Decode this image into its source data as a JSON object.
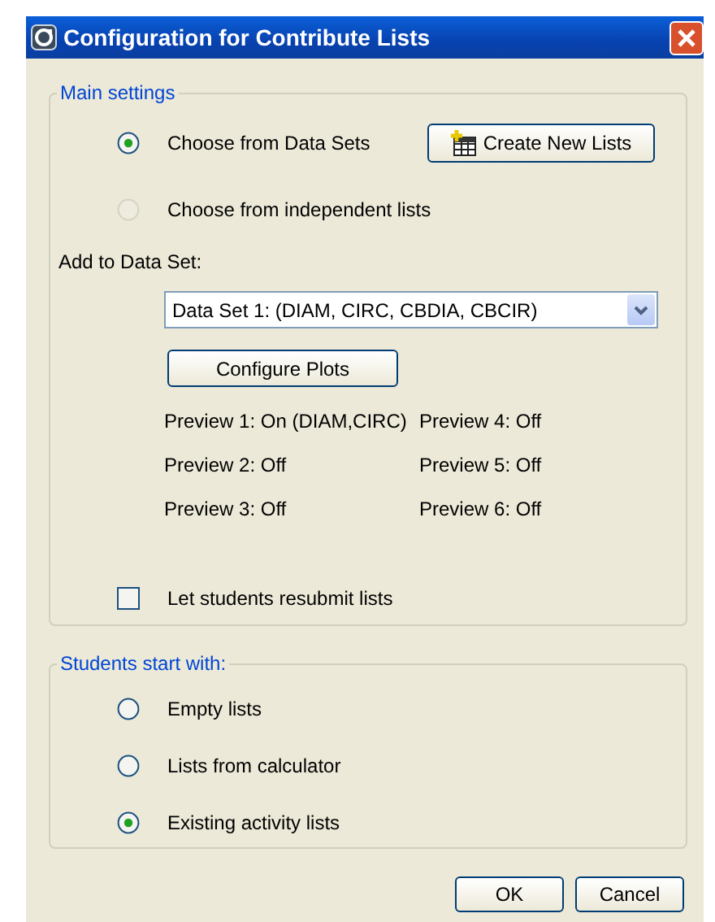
{
  "window": {
    "title": "Configuration for Contribute Lists"
  },
  "main_settings": {
    "legend": "Main settings",
    "source_options": [
      {
        "label": "Choose from Data Sets",
        "selected": true,
        "disabled": false
      },
      {
        "label": "Choose from independent lists",
        "selected": false,
        "disabled": true
      }
    ],
    "create_button": "Create New Lists",
    "add_to_label": "Add to Data Set:",
    "data_set": {
      "value": "Data Set 1: (DIAM, CIRC, CBDIA, CBCIR)"
    },
    "configure_button": "Configure Plots",
    "previews": [
      "Preview 1: On (DIAM,CIRC)",
      "Preview 2: Off",
      "Preview 3: Off",
      "Preview 4: Off",
      "Preview 5: Off",
      "Preview 6: Off"
    ],
    "resubmit": {
      "label": "Let students resubmit lists",
      "checked": false
    }
  },
  "students_start": {
    "legend": "Students start with:",
    "options": [
      {
        "label": "Empty lists",
        "selected": false
      },
      {
        "label": "Lists from calculator",
        "selected": false
      },
      {
        "label": "Existing activity lists",
        "selected": true
      }
    ]
  },
  "buttons": [
    "OK",
    "Cancel"
  ]
}
